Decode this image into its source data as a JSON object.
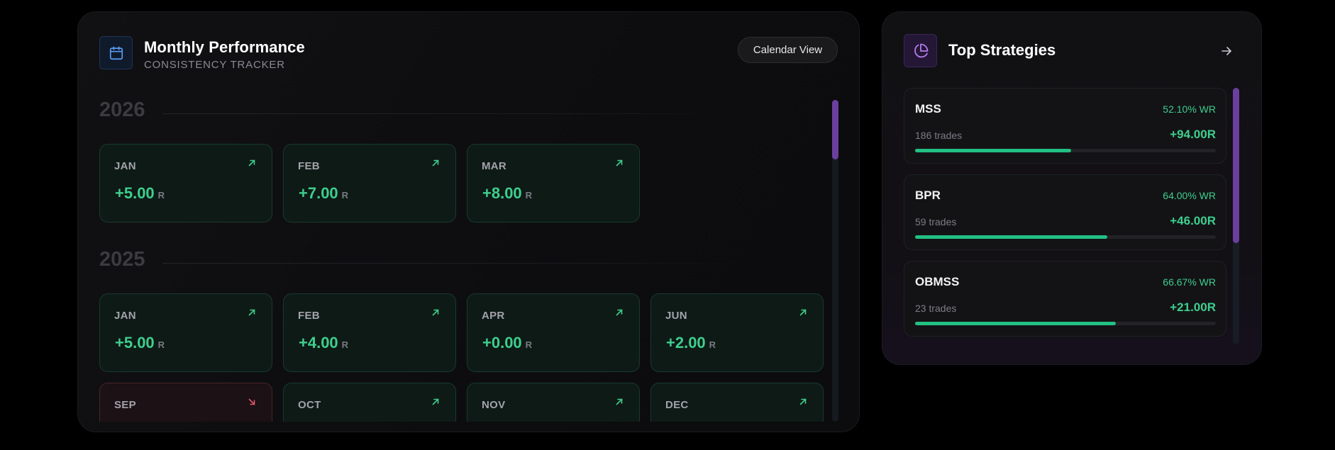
{
  "monthly": {
    "title": "Monthly Performance",
    "subtitle": "CONSISTENCY TRACKER",
    "calendar_button": "Calendar View",
    "icon": "calendar-icon",
    "years": [
      {
        "year": "2026",
        "months": [
          {
            "name": "JAN",
            "value": "+5.00",
            "unit": "R",
            "trend": "up"
          },
          {
            "name": "FEB",
            "value": "+7.00",
            "unit": "R",
            "trend": "up"
          },
          {
            "name": "MAR",
            "value": "+8.00",
            "unit": "R",
            "trend": "up"
          }
        ]
      },
      {
        "year": "2025",
        "months": [
          {
            "name": "JAN",
            "value": "+5.00",
            "unit": "R",
            "trend": "up"
          },
          {
            "name": "FEB",
            "value": "+4.00",
            "unit": "R",
            "trend": "up"
          },
          {
            "name": "APR",
            "value": "+0.00",
            "unit": "R",
            "trend": "up"
          },
          {
            "name": "JUN",
            "value": "+2.00",
            "unit": "R",
            "trend": "up"
          },
          {
            "name": "SEP",
            "trend": "down"
          },
          {
            "name": "OCT",
            "trend": "up"
          },
          {
            "name": "NOV",
            "trend": "up"
          },
          {
            "name": "DEC",
            "trend": "up"
          }
        ]
      }
    ]
  },
  "strategies": {
    "title": "Top Strategies",
    "icon": "pie-chart-icon",
    "open_icon": "arrow-right-icon",
    "items": [
      {
        "name": "MSS",
        "win_rate": "52.10% WR",
        "trades": "186 trades",
        "r_total": "+94.00R",
        "progress": 0.52
      },
      {
        "name": "BPR",
        "win_rate": "64.00% WR",
        "trades": "59 trades",
        "r_total": "+46.00R",
        "progress": 0.64
      },
      {
        "name": "OBMSS",
        "win_rate": "66.67% WR",
        "trades": "23 trades",
        "r_total": "+21.00R",
        "progress": 0.667
      }
    ]
  },
  "colors": {
    "positive": "#3ecf8e",
    "negative": "#e0566a",
    "accent_purple": "#6a3f9e",
    "accent_blue": "#5b9bf0"
  }
}
